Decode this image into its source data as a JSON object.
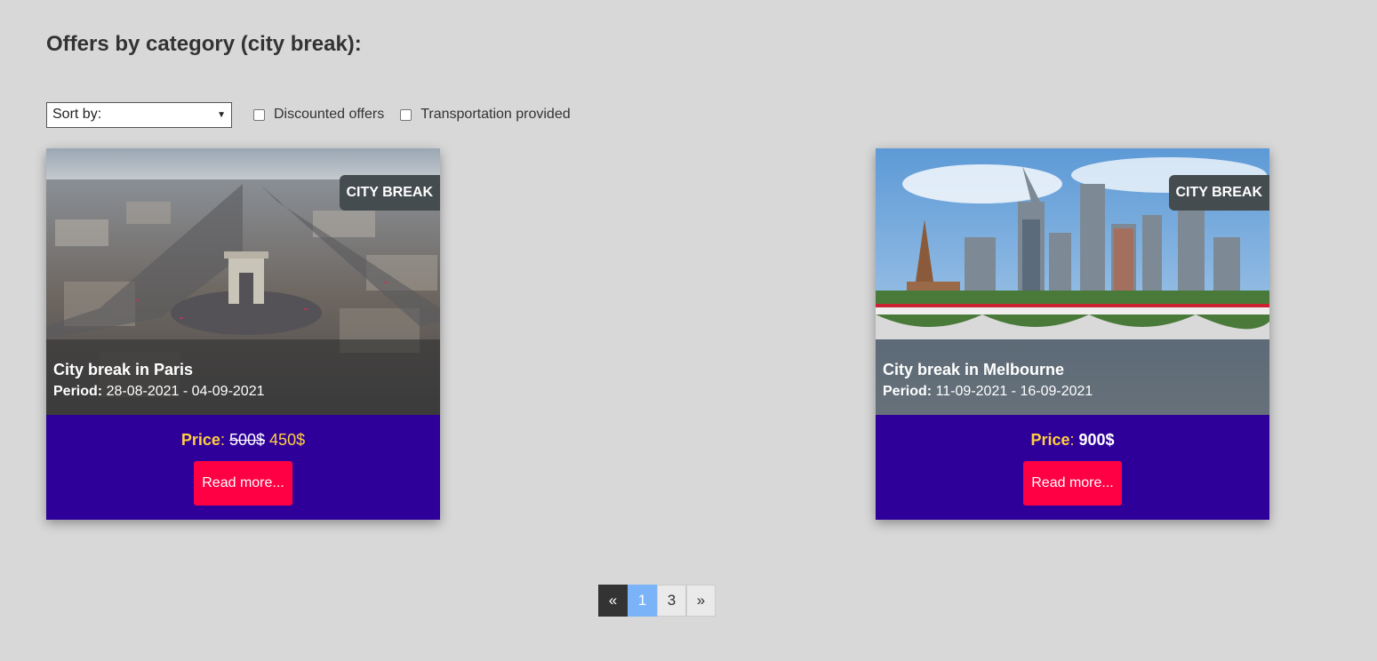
{
  "page": {
    "title": "Offers by category (city break):"
  },
  "filters": {
    "sort_label": "Sort by:",
    "discounted_label": "Discounted offers",
    "transportation_label": "Transportation provided"
  },
  "cards": [
    {
      "badge": "CITY BREAK",
      "title": "City break in Paris",
      "period_label": "Period:",
      "period": "28-08-2021 - 04-09-2021",
      "price_label": "Price",
      "price_sep": ":",
      "old_price": "500$",
      "new_price": "450$",
      "button": "Read more..."
    },
    {
      "badge": "CITY BREAK",
      "title": "City break in Melbourne",
      "period_label": "Period:",
      "period": "11-09-2021 - 16-09-2021",
      "price_label": "Price",
      "price_sep": ":",
      "price": "900$",
      "button": "Read more..."
    }
  ],
  "pagination": {
    "prev": "«",
    "pages": [
      "1",
      "3"
    ],
    "next": "»"
  },
  "colors": {
    "background": "#d8d8d8",
    "card_bottom": "#2f0099",
    "button": "#ff0044",
    "price_accent": "#ffcf40",
    "active_page": "#7ab3f7"
  }
}
